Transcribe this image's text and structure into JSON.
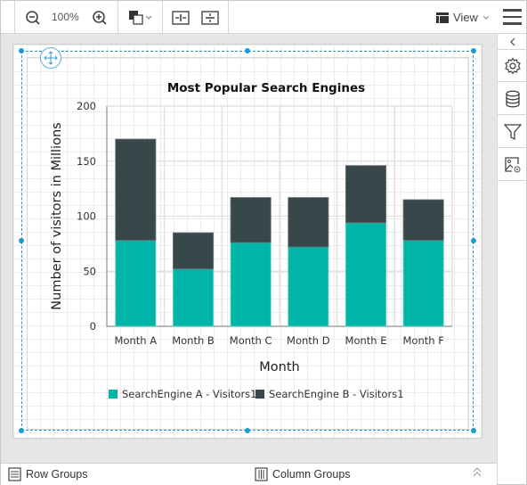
{
  "toolbar": {
    "zoom_level": "100%",
    "view_label": "View"
  },
  "bottom": {
    "row_groups_label": "Row Groups",
    "column_groups_label": "Column Groups"
  },
  "colors": {
    "series_a": "#00b5a8",
    "series_b": "#37474a",
    "selection": "#1a9ad6"
  },
  "chart_data": {
    "type": "bar",
    "stacked": true,
    "title": "Most Popular Search Engines",
    "xlabel": "Month",
    "ylabel": "Number of visitors in Millions",
    "categories": [
      "Month A",
      "Month B",
      "Month C",
      "Month D",
      "Month E",
      "Month F"
    ],
    "series": [
      {
        "name": "SearchEngine A - Visitors1",
        "color": "#00b5a8",
        "values": [
          78,
          52,
          76,
          72,
          94,
          78
        ]
      },
      {
        "name": "SearchEngine B - Visitors1",
        "color": "#37474a",
        "values": [
          92,
          33,
          41,
          45,
          52,
          37
        ]
      }
    ],
    "ylim": [
      0,
      200
    ],
    "yticks": [
      0,
      50,
      100,
      150,
      200
    ],
    "grid": true,
    "legend_position": "bottom"
  }
}
